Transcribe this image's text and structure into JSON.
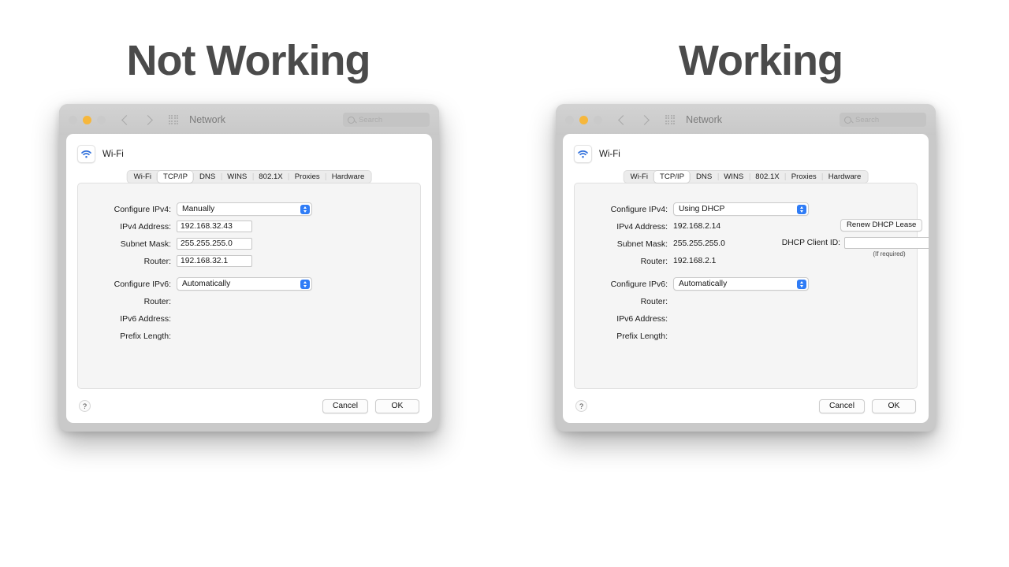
{
  "headings": {
    "left": "Not Working",
    "right": "Working"
  },
  "toolbar": {
    "title": "Network",
    "search_placeholder": "Search",
    "back_icon": "chevron-left-icon",
    "forward_icon": "chevron-right-icon",
    "grid_icon": "grid-apps-icon",
    "search_icon": "search-icon"
  },
  "sheet": {
    "service_name": "Wi-Fi",
    "wifi_icon": "wifi-icon",
    "tabs": [
      {
        "label": "Wi-Fi",
        "active": false
      },
      {
        "label": "TCP/IP",
        "active": true
      },
      {
        "label": "DNS",
        "active": false
      },
      {
        "label": "WINS",
        "active": false
      },
      {
        "label": "802.1X",
        "active": false
      },
      {
        "label": "Proxies",
        "active": false
      },
      {
        "label": "Hardware",
        "active": false
      }
    ],
    "labels": {
      "configure_ipv4": "Configure IPv4:",
      "ipv4_address": "IPv4 Address:",
      "subnet_mask": "Subnet Mask:",
      "router": "Router:",
      "configure_ipv6": "Configure IPv6:",
      "ipv6_router": "Router:",
      "ipv6_address": "IPv6 Address:",
      "prefix_length": "Prefix Length:"
    },
    "footer": {
      "help_label": "?",
      "cancel_label": "Cancel",
      "ok_label": "OK"
    }
  },
  "left_panel": {
    "configure_ipv4_value": "Manually",
    "ipv4_address_value": "192.168.32.43",
    "subnet_mask_value": "255.255.255.0",
    "router_value": "192.168.32.1",
    "configure_ipv6_value": "Automatically",
    "ipv6_router_value": "",
    "ipv6_address_value": "",
    "prefix_length_value": ""
  },
  "right_panel": {
    "configure_ipv4_value": "Using DHCP",
    "ipv4_address_value": "192.168.2.14",
    "subnet_mask_value": "255.255.255.0",
    "router_value": "192.168.2.1",
    "renew_dhcp_lease_label": "Renew DHCP Lease",
    "dhcp_client_id_label": "DHCP Client ID:",
    "dhcp_client_id_value": "",
    "dhcp_client_id_hint": "(If required)",
    "configure_ipv6_value": "Automatically",
    "ipv6_router_value": "",
    "ipv6_address_value": "",
    "prefix_length_value": ""
  },
  "colors": {
    "accent_blue": "#2f7cf6",
    "wifi_glyph": "#2f6fdb",
    "traffic_amber": "#f6b73c",
    "heading_gray": "#4b4b4b",
    "panel_bg": "#f5f5f5"
  }
}
